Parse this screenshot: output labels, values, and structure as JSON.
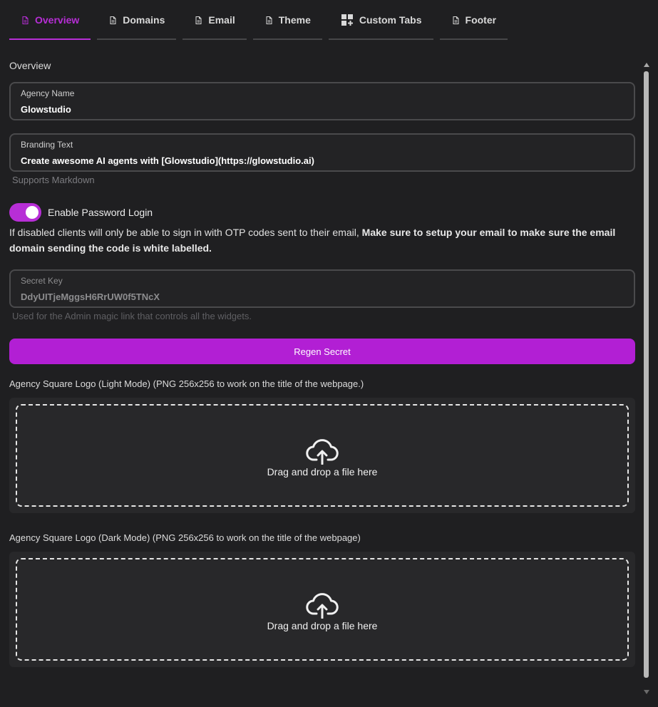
{
  "colors": {
    "accent": "#b72ed6",
    "button": "#b21fd4",
    "background": "#1f1f21"
  },
  "tabs": [
    {
      "label": "Overview",
      "icon": "document-icon",
      "active": true
    },
    {
      "label": "Domains",
      "icon": "document-icon",
      "active": false
    },
    {
      "label": "Email",
      "icon": "document-icon",
      "active": false
    },
    {
      "label": "Theme",
      "icon": "document-icon",
      "active": false
    },
    {
      "label": "Custom Tabs",
      "icon": "widgets-add-icon",
      "active": false
    },
    {
      "label": "Footer",
      "icon": "document-icon",
      "active": false
    }
  ],
  "overview": {
    "section_title": "Overview",
    "agency_name": {
      "label": "Agency Name",
      "value": "Glowstudio"
    },
    "branding_text": {
      "label": "Branding Text",
      "value": "Create awesome AI agents with [Glowstudio](https://glowstudio.ai)",
      "helper": "Supports Markdown"
    },
    "password_login": {
      "label": "Enable Password Login",
      "enabled": true,
      "description_plain": "If disabled clients will only be able to sign in with OTP codes sent to their email, ",
      "description_bold": "Make sure to setup your email to make sure the email domain sending the code is white labelled."
    },
    "secret_key": {
      "label": "Secret Key",
      "value": "DdyUITjeMggsH6RrUW0f5TNcX",
      "helper": "Used for the Admin magic link that controls all the widgets."
    },
    "regen_button": "Regen Secret",
    "logo_light": {
      "title": "Agency Square Logo (Light Mode) (PNG 256x256 to work on the title of the webpage.)",
      "dropzone_text": "Drag and drop a file here",
      "icon": "cloud-upload-icon"
    },
    "logo_dark": {
      "title": "Agency Square Logo (Dark Mode) (PNG 256x256 to work on the title of the webpage)",
      "dropzone_text": "Drag and drop a file here",
      "icon": "cloud-upload-icon"
    }
  }
}
